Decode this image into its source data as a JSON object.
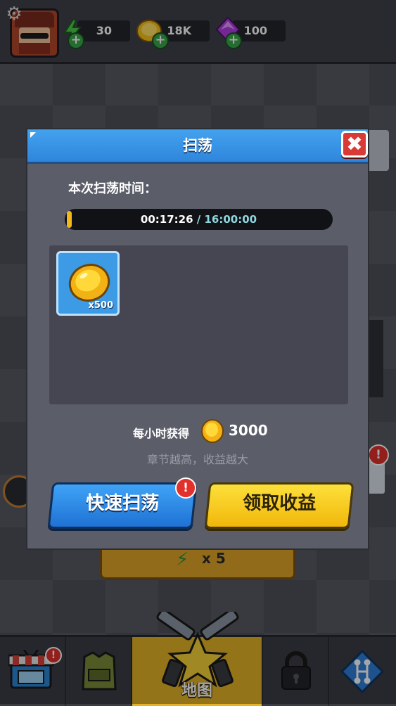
{
  "resources": {
    "energy": "30",
    "gold": "18K",
    "gems": "100"
  },
  "background_button": {
    "label": "x 5"
  },
  "dialog": {
    "title": "扫荡",
    "close_symbol": "✖",
    "time_label": "本次扫荡时间：",
    "progress": {
      "current": "00:17:26",
      "separator": " / ",
      "total": "16:00:00",
      "fraction": 0.018
    },
    "reward": {
      "item": "gold-coin",
      "quantity": "x500"
    },
    "rate_label": "每小时获得",
    "rate_value": "3000",
    "hint": "章节越高，收益越大",
    "quick_button": "快速扫荡",
    "collect_button": "领取收益"
  },
  "bottom_nav": {
    "items": [
      {
        "name": "shop",
        "icon": "shop-icon"
      },
      {
        "name": "armor",
        "icon": "armor-icon"
      },
      {
        "name": "map",
        "label": "地图",
        "icon": "map-star-icon"
      },
      {
        "name": "locked",
        "icon": "lock-icon"
      },
      {
        "name": "skills",
        "icon": "skill-tree-icon"
      }
    ]
  },
  "colors": {
    "dialog_header": "#2f86dc",
    "quick_button": "#1f72d4",
    "collect_button": "#f1b70b",
    "active_tab": "#e3b325",
    "badge": "#e2302b"
  }
}
